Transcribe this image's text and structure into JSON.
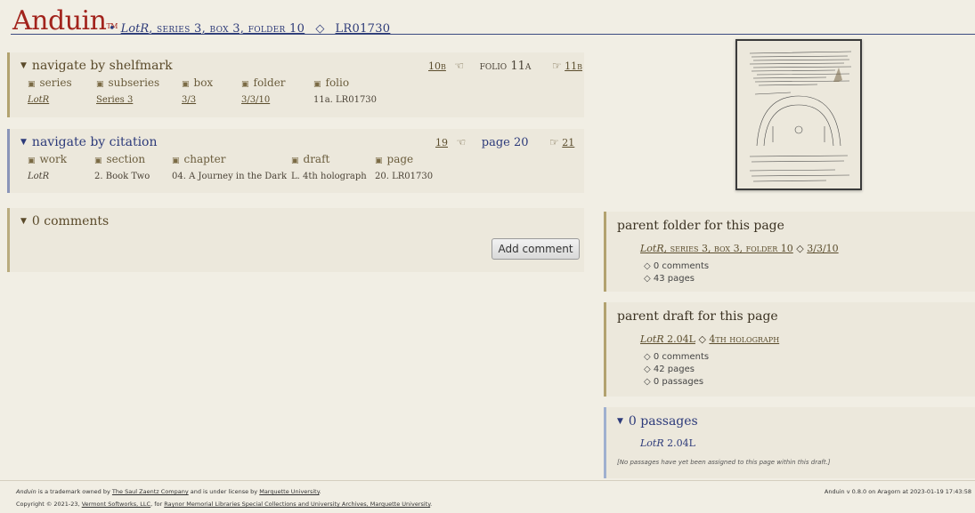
{
  "header": {
    "logo": "Anduin",
    "logo_tm": "TM",
    "breadcrumb_sep": "•",
    "breadcrumb_work": "LotR",
    "breadcrumb_rest": ", series 3, box 3, folder 10",
    "breadcrumb_diamond": "◇",
    "breadcrumb_id": "LR01730"
  },
  "shelfmark": {
    "title": "navigate by shelfmark",
    "prev": "10b",
    "current": "folio 11a",
    "next": "11b",
    "columns": [
      {
        "heading": "series",
        "value": "LotR"
      },
      {
        "heading": "subseries",
        "value": "Series 3"
      },
      {
        "heading": "box",
        "value": "3/3"
      },
      {
        "heading": "folder",
        "value": "3/3/10"
      },
      {
        "heading": "folio",
        "value": "11a. LR01730"
      }
    ]
  },
  "citation": {
    "title": "navigate by citation",
    "prev": "19",
    "current": "page 20",
    "next": "21",
    "columns": [
      {
        "heading": "work",
        "value": "LotR"
      },
      {
        "heading": "section",
        "value": "2. Book Two"
      },
      {
        "heading": "chapter",
        "value": "04. A Journey in the Dark"
      },
      {
        "heading": "draft",
        "value": "L. 4th holograph"
      },
      {
        "heading": "page",
        "value": "20. LR01730"
      }
    ]
  },
  "comments": {
    "title": "0 comments",
    "add_button": "Add comment"
  },
  "parent_folder": {
    "title": "parent folder for this page",
    "link_work": "LotR",
    "link_rest": ", series 3, box 3, folder 10",
    "link_diamond": "◇",
    "link_id": "3/3/10",
    "items": [
      "◇ 0 comments",
      "◇ 43 pages"
    ]
  },
  "parent_draft": {
    "title": "parent draft for this page",
    "link_work": "LotR",
    "link_rest": " 2.04L",
    "link_diamond": "◇",
    "link_id": "4th holograph",
    "items": [
      "◇ 0 comments",
      "◇ 42 pages",
      "◇ 0 passages"
    ]
  },
  "passages": {
    "title": "0 passages",
    "link_work": "LotR",
    "link_rest": " 2.04L",
    "note": "[No passages have yet been assigned to this page within this draft.]"
  },
  "footer": {
    "line1_a": "Anduin",
    "line1_b": " is a trademark owned by ",
    "line1_link": "The Saul Zaentz Company",
    "line1_c": " and is under license by ",
    "line1_link2": "Marquette University",
    "line1_d": ".",
    "line2_a": "Copyright © 2021-23, ",
    "line2_link": "Vermont Softworks, LLC",
    "line2_b": ", for ",
    "line2_link2": "Raynor Memorial Libraries Special Collections and University Archives, Marquette University",
    "line2_c": ".",
    "version": "Anduin v 0.8.0 on Aragorn at 2023-01-19 17:43:58"
  },
  "colors": {
    "logo_red": "#a2231c",
    "nav_blue": "#2c3a7a",
    "border_tan": "#b2a26f",
    "background": "#f1eee4"
  }
}
